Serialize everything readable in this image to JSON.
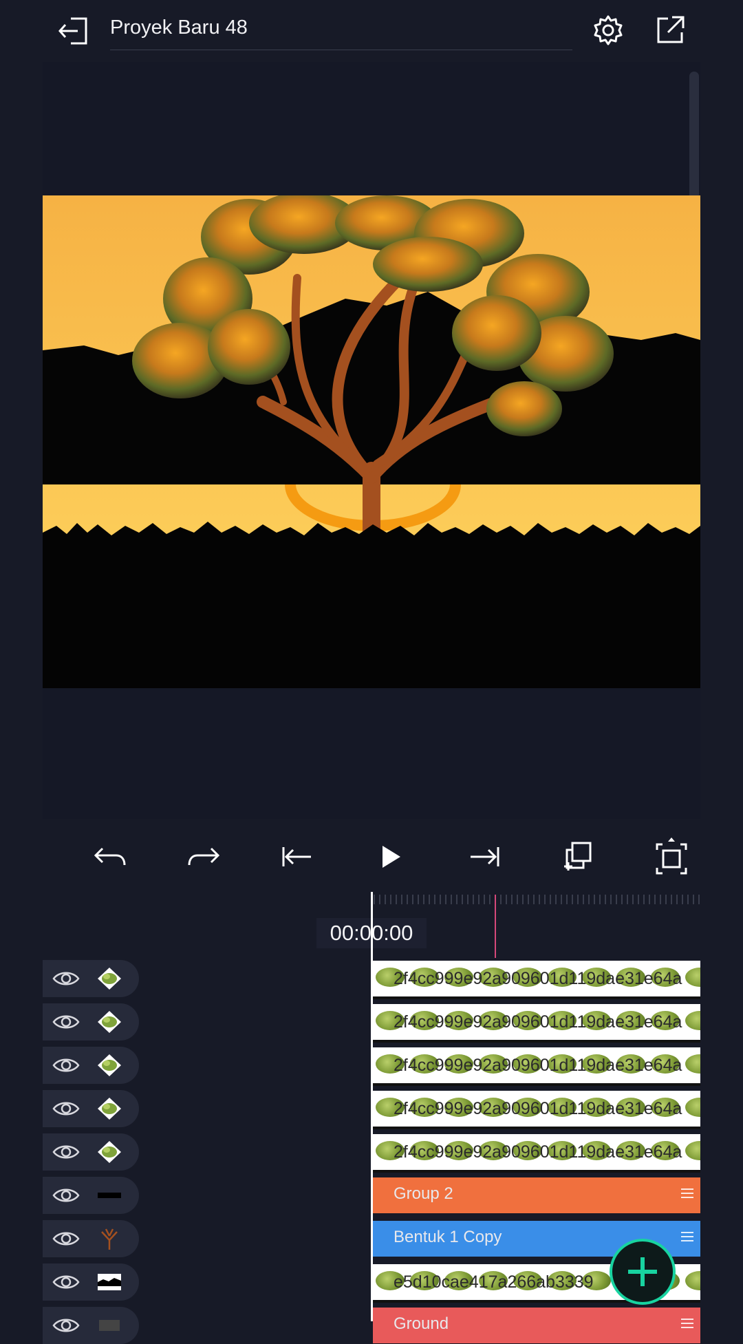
{
  "header": {
    "title": "Proyek Baru 48",
    "exit_icon": "exit-door-icon",
    "settings_icon": "gear-icon",
    "export_icon": "share-external-icon"
  },
  "toolbar": {
    "buttons": [
      {
        "name": "undo-button",
        "icon": "undo-arrow-icon"
      },
      {
        "name": "redo-button",
        "icon": "redo-arrow-icon"
      },
      {
        "name": "jump-start-button",
        "icon": "skip-to-start-icon"
      },
      {
        "name": "play-button",
        "icon": "play-icon"
      },
      {
        "name": "jump-end-button",
        "icon": "skip-to-end-icon"
      },
      {
        "name": "duplicate-button",
        "icon": "add-copy-icon"
      },
      {
        "name": "fit-screen-button",
        "icon": "fullscreen-frame-icon"
      }
    ]
  },
  "timeline": {
    "timecode": "00:00:00",
    "layers": [
      {
        "label": "2f4cc999e92a909601d119dae31e64a",
        "type": "image",
        "thumb": "bush-icon"
      },
      {
        "label": "2f4cc999e92a909601d119dae31e64a",
        "type": "image",
        "thumb": "bush-icon"
      },
      {
        "label": "2f4cc999e92a909601d119dae31e64a",
        "type": "image",
        "thumb": "bush-icon"
      },
      {
        "label": "2f4cc999e92a909601d119dae31e64a",
        "type": "image",
        "thumb": "bush-icon"
      },
      {
        "label": "2f4cc999e92a909601d119dae31e64a",
        "type": "image",
        "thumb": "bush-icon"
      },
      {
        "label": "Group 2",
        "type": "group",
        "color": "#f0703e",
        "thumb": "black-bar-icon"
      },
      {
        "label": "Bentuk 1 Copy",
        "type": "shape",
        "color": "#3a8ee8",
        "thumb": "tree-branch-icon"
      },
      {
        "label": "e5d10cae417a266ab3339",
        "type": "image",
        "thumb": "landscape-icon"
      },
      {
        "label": "Ground",
        "type": "shape",
        "color": "#e85a5a",
        "thumb": "layer-icon"
      }
    ]
  },
  "colors": {
    "background": "#171a27",
    "sky_top": "#f7b846",
    "sky_bottom": "#ffd55e",
    "trunk": "#a4501f",
    "accent_fab": "#18d3a0",
    "marker": "#d6487a"
  },
  "fab": {
    "icon": "plus-icon"
  }
}
